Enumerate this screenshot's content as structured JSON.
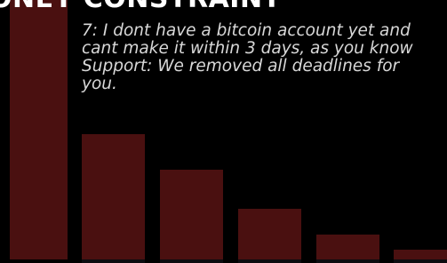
{
  "heading": "ONEY CONSTRAINT",
  "chat_lines": [
    "7: I dont have a bitcoin account yet and",
    "cant make it within 3 days, as you know",
    "Support: We removed all deadlines for",
    "you."
  ],
  "bar_color": "#4a1010",
  "background_color": "#000000"
}
